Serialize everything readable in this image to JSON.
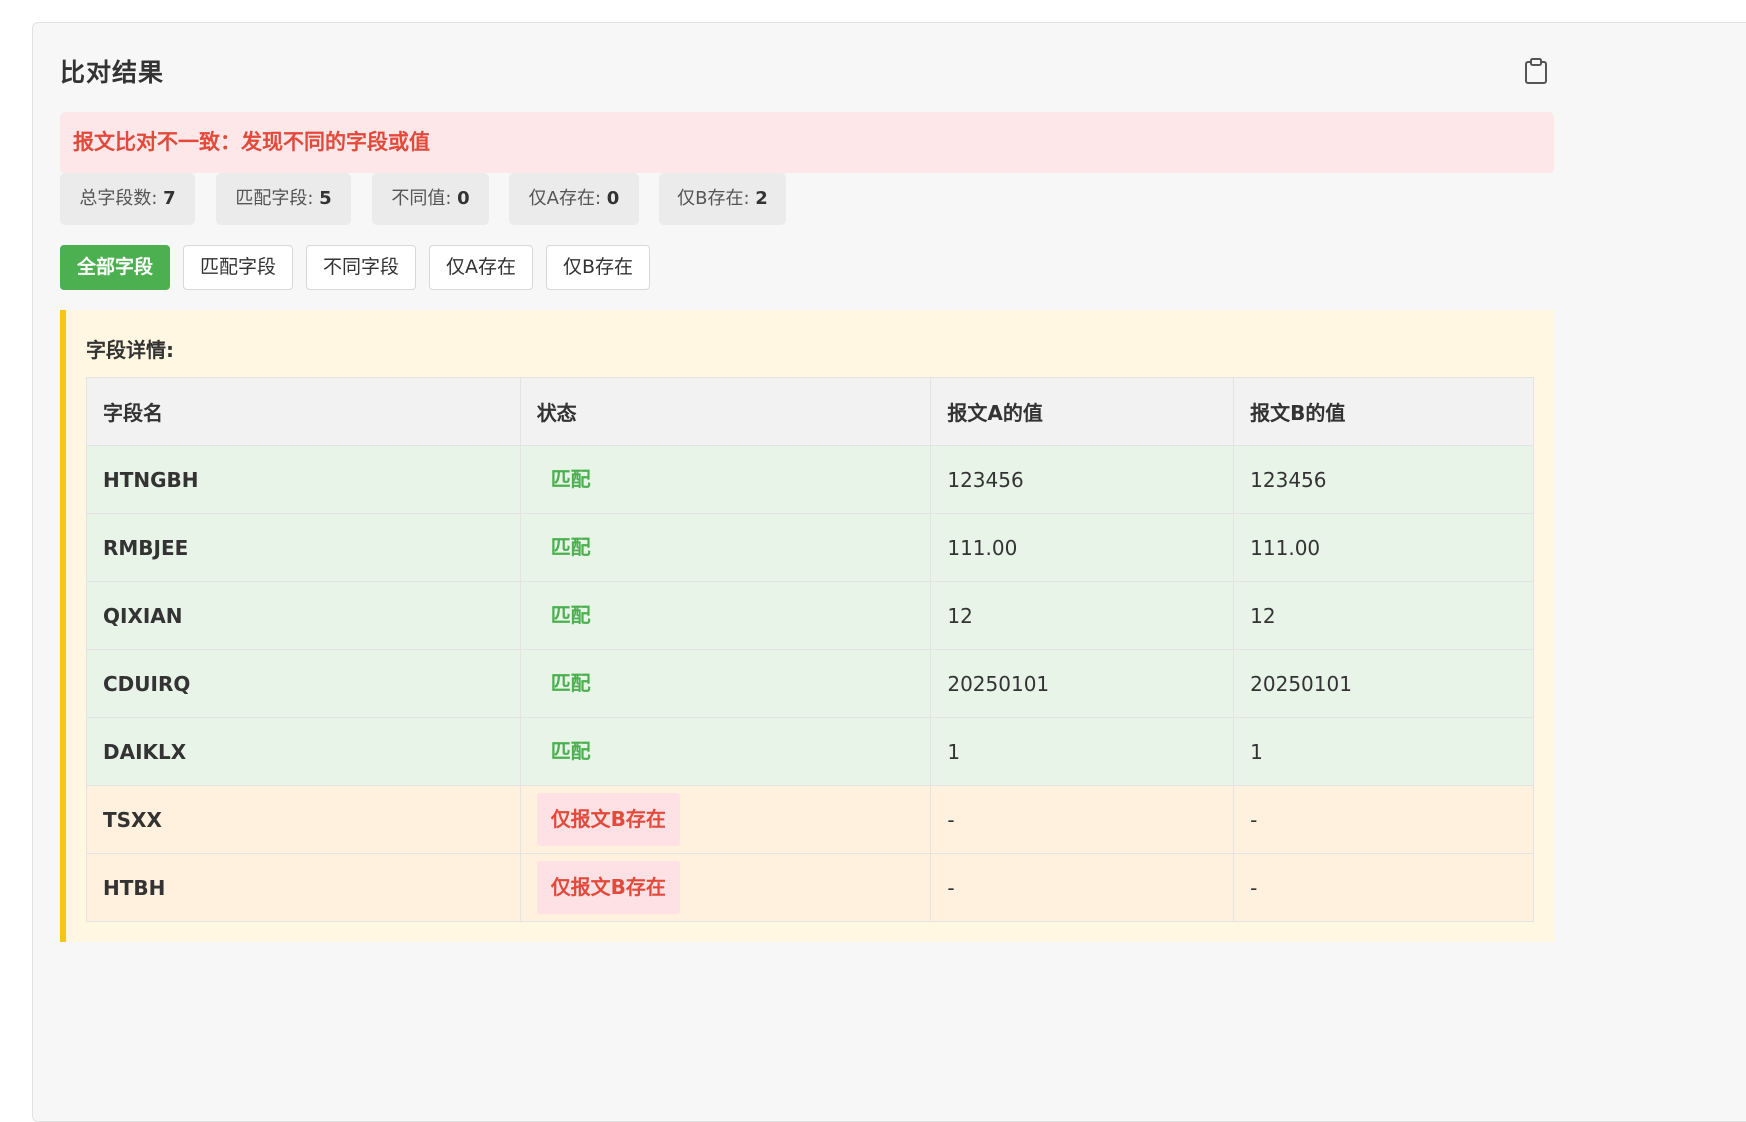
{
  "panel": {
    "title": "比对结果",
    "copy_icon": "clipboard-icon"
  },
  "alert": {
    "text": "报文比对不一致：发现不同的字段或值",
    "color": "#e24a3b"
  },
  "stats": [
    {
      "label": "总字段数: ",
      "value": "7"
    },
    {
      "label": "匹配字段: ",
      "value": "5"
    },
    {
      "label": "不同值: ",
      "value": "0"
    },
    {
      "label": "仅A存在: ",
      "value": "0"
    },
    {
      "label": "仅B存在: ",
      "value": "2"
    }
  ],
  "filters": [
    {
      "label": "全部字段",
      "active": true
    },
    {
      "label": "匹配字段",
      "active": false
    },
    {
      "label": "不同字段",
      "active": false
    },
    {
      "label": "仅A存在",
      "active": false
    },
    {
      "label": "仅B存在",
      "active": false
    }
  ],
  "colors": {
    "accent_green": "#4caf50",
    "accent_yellow": "#f5c518",
    "error_red": "#e24a3b"
  },
  "detail": {
    "title": "字段详情:",
    "columns": [
      "字段名",
      "状态",
      "报文A的值",
      "报文B的值"
    ],
    "rows": [
      {
        "name": "HTNGBH",
        "status": "匹配",
        "type": "match",
        "a": "123456",
        "b": "123456"
      },
      {
        "name": "RMBJEE",
        "status": "匹配",
        "type": "match",
        "a": "111.00",
        "b": "111.00"
      },
      {
        "name": "QIXIAN",
        "status": "匹配",
        "type": "match",
        "a": "12",
        "b": "12"
      },
      {
        "name": "CDUIRQ",
        "status": "匹配",
        "type": "match",
        "a": "20250101",
        "b": "20250101"
      },
      {
        "name": "DAIKLX",
        "status": "匹配",
        "type": "match",
        "a": "1",
        "b": "1"
      },
      {
        "name": "TSXX",
        "status": "仅报文B存在",
        "type": "onlyb",
        "a": "-",
        "b": "-"
      },
      {
        "name": "HTBH",
        "status": "仅报文B存在",
        "type": "onlyb",
        "a": "-",
        "b": "-"
      }
    ]
  }
}
